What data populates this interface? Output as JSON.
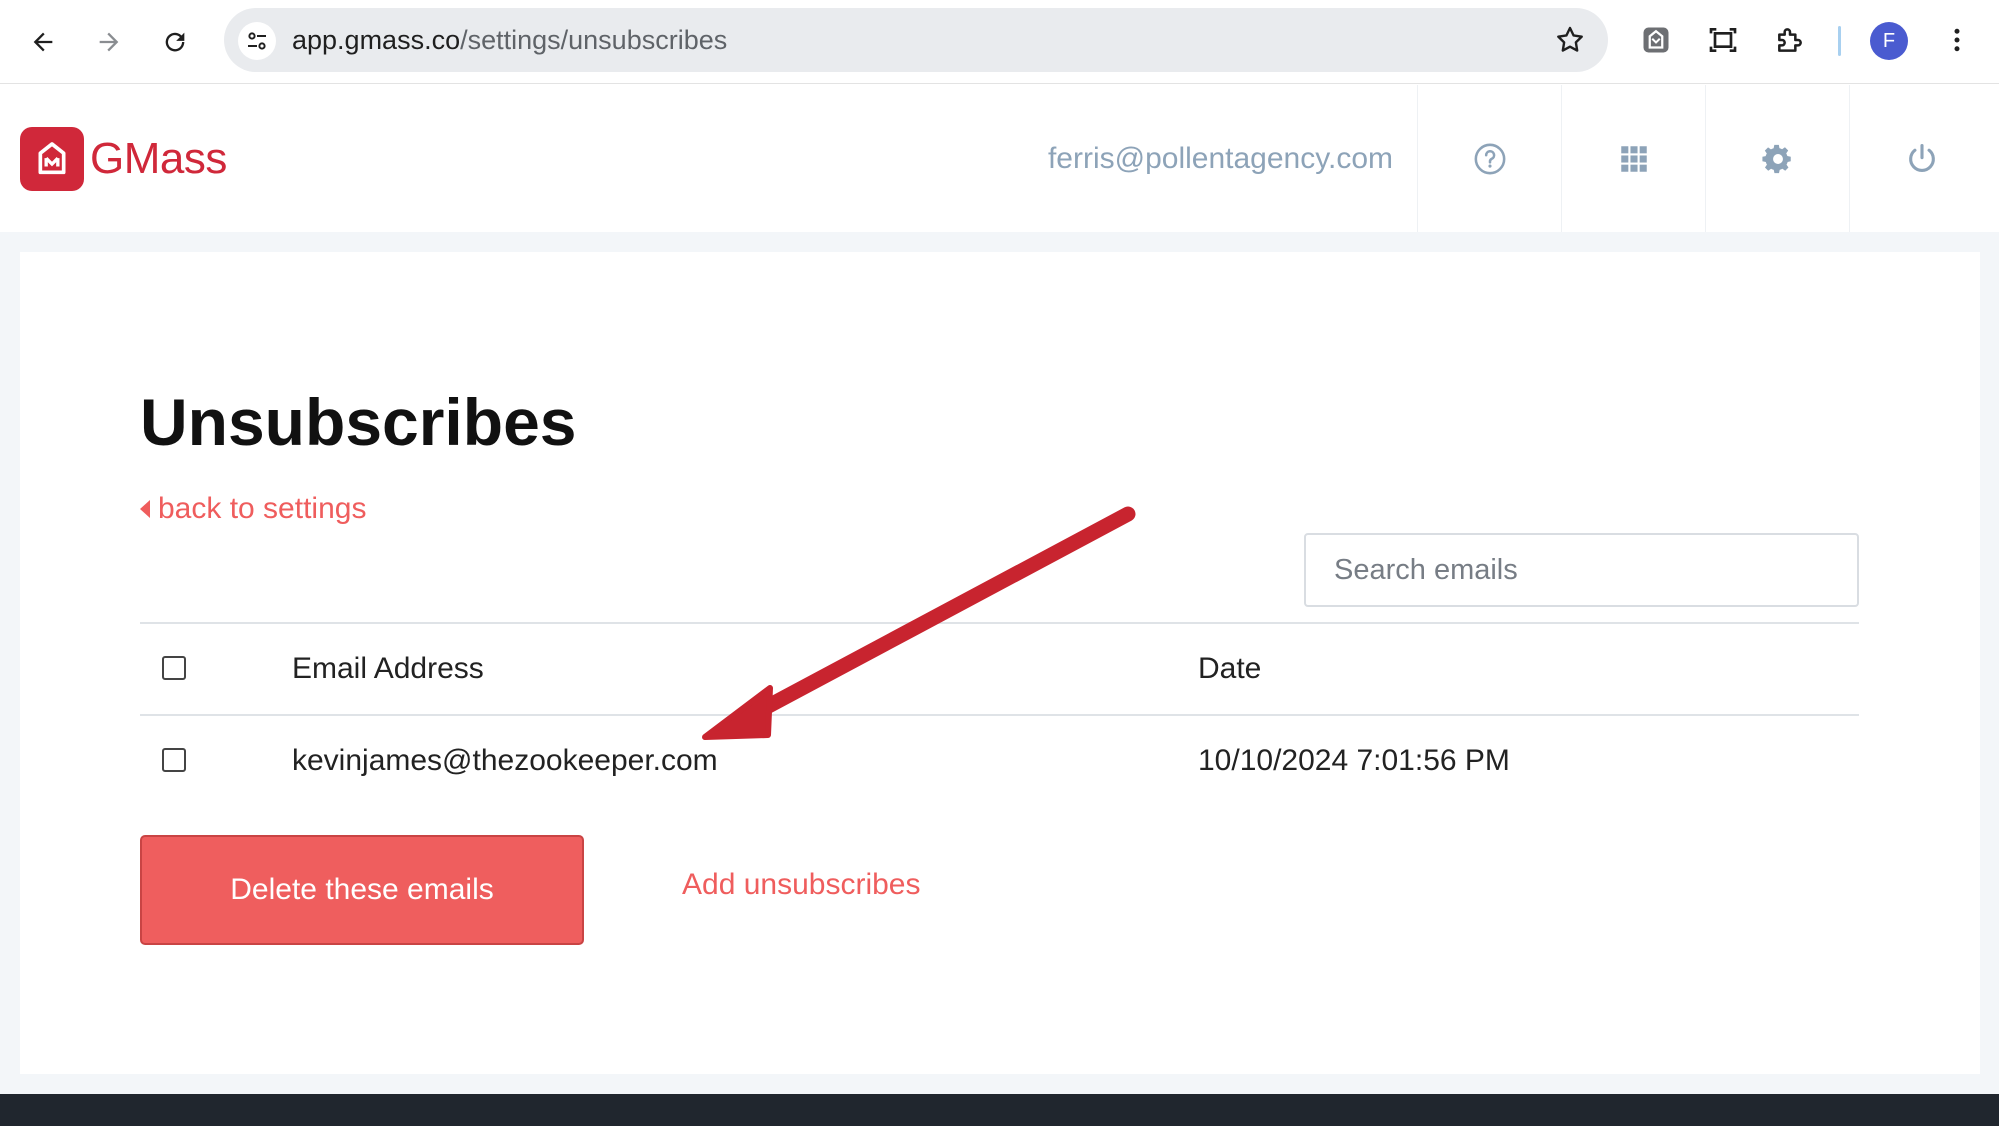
{
  "browser": {
    "url_host": "app.gmass.co",
    "url_path": "/settings/unsubscribes",
    "profile_initial": "F",
    "icons": [
      "back-arrow-icon",
      "forward-arrow-icon",
      "reload-icon",
      "site-settings-icon",
      "bookmark-star-icon",
      "gmass-extension-icon",
      "screenshot-icon",
      "extensions-puzzle-icon",
      "more-vert-icon"
    ]
  },
  "header": {
    "logo_text": "GMass",
    "user_email": "ferris@pollentagency.com",
    "icons": [
      "help-icon",
      "apps-grid-icon",
      "settings-gear-icon",
      "power-icon"
    ]
  },
  "page": {
    "title": "Unsubscribes",
    "back_label": "back to settings",
    "search_placeholder": "Search emails"
  },
  "table": {
    "headers": [
      "Email Address",
      "Date"
    ],
    "rows": [
      {
        "email": "kevinjames@thezookeeper.com",
        "date": "10/10/2024 7:01:56 PM"
      }
    ]
  },
  "actions": {
    "delete_label": "Delete these emails",
    "add_label": "Add unsubscribes"
  },
  "colors": {
    "brand_red": "#d0283a",
    "accent_coral": "#ef5e5e",
    "annotation_arrow": "#c8242f",
    "muted_text": "#8da3b8"
  }
}
